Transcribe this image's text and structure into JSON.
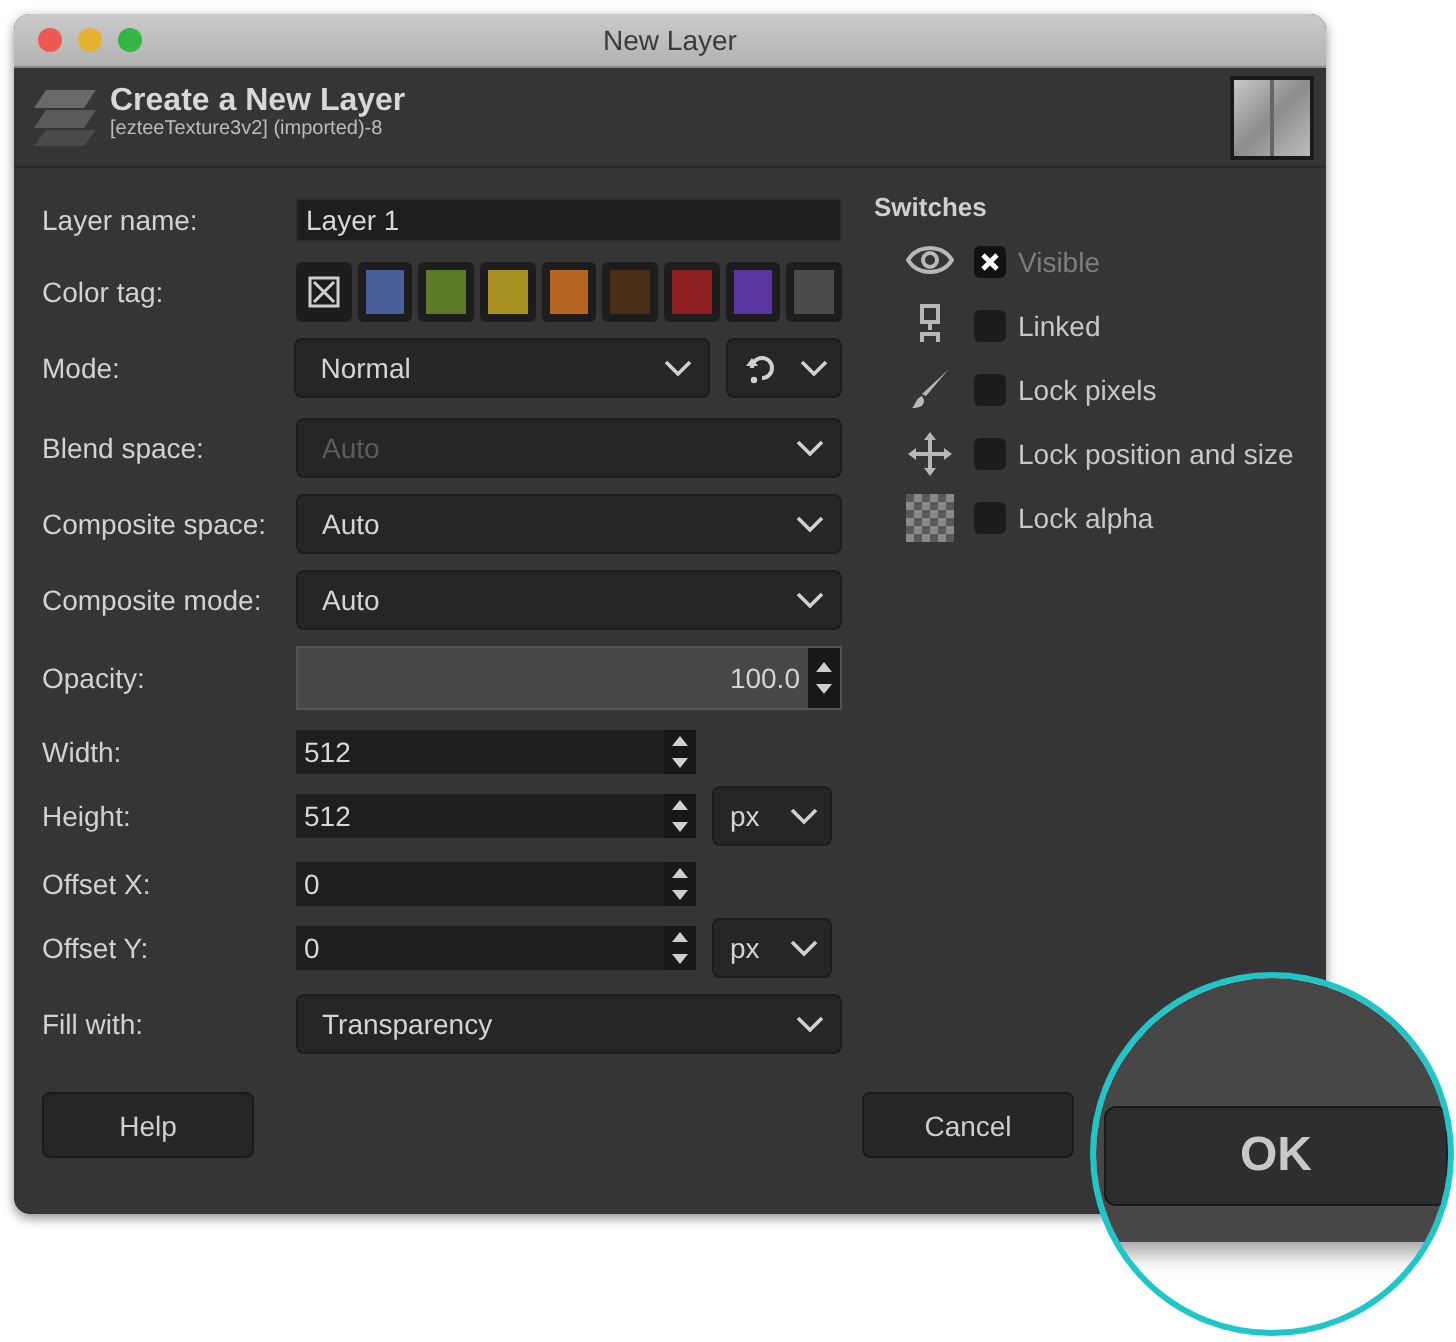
{
  "window": {
    "title": "New Layer"
  },
  "header": {
    "title": "Create a New Layer",
    "subtitle": "[ezteeTexture3v2] (imported)-8"
  },
  "fields": [
    {
      "kind": "text",
      "label": "Layer name:",
      "value": "Layer 1"
    },
    {
      "kind": "colortags",
      "label": "Color tag:",
      "tags": [
        {
          "kind": "none"
        },
        {
          "kind": "color",
          "color": "#4a5f9a"
        },
        {
          "kind": "color",
          "color": "#5a7a2a"
        },
        {
          "kind": "color",
          "color": "#a89020"
        },
        {
          "kind": "color",
          "color": "#b56520"
        },
        {
          "kind": "color",
          "color": "#4a2e16"
        },
        {
          "kind": "color",
          "color": "#8e2022"
        },
        {
          "kind": "color",
          "color": "#5a34a0"
        },
        {
          "kind": "color",
          "color": "#4a4a4a"
        }
      ]
    },
    {
      "kind": "mode",
      "label": "Mode:",
      "value": "Normal"
    },
    {
      "kind": "select",
      "label": "Blend space:",
      "value": "Auto",
      "disabled": true
    },
    {
      "kind": "select",
      "label": "Composite space:",
      "value": "Auto",
      "disabled": false
    },
    {
      "kind": "select",
      "label": "Composite mode:",
      "value": "Auto",
      "disabled": false
    },
    {
      "kind": "slider",
      "label": "Opacity:",
      "value": "100.0",
      "level": 1
    },
    {
      "kind": "spin",
      "label": "Width:",
      "value": "512"
    },
    {
      "kind": "spin",
      "label": "Height:",
      "value": "512",
      "unit": "px"
    },
    {
      "kind": "spin",
      "label": "Offset X:",
      "value": "0"
    },
    {
      "kind": "spin",
      "label": "Offset Y:",
      "value": "0",
      "unit": "px"
    },
    {
      "kind": "select",
      "label": "Fill with:",
      "value": "Transparency",
      "disabled": false
    }
  ],
  "switches": {
    "title": "Switches",
    "items": [
      {
        "kind": "eye",
        "label": "Visible",
        "checked": true,
        "disabled": true
      },
      {
        "kind": "chain",
        "label": "Linked",
        "checked": false,
        "disabled": false
      },
      {
        "kind": "brush",
        "label": "Lock pixels",
        "checked": false,
        "disabled": false
      },
      {
        "kind": "move",
        "label": "Lock position and size",
        "checked": false,
        "disabled": false
      },
      {
        "kind": "checker",
        "label": "Lock alpha",
        "checked": false,
        "disabled": false
      }
    ]
  },
  "buttons": {
    "left": "Help",
    "right": "Cancel"
  },
  "callout": {
    "button": "OK"
  }
}
